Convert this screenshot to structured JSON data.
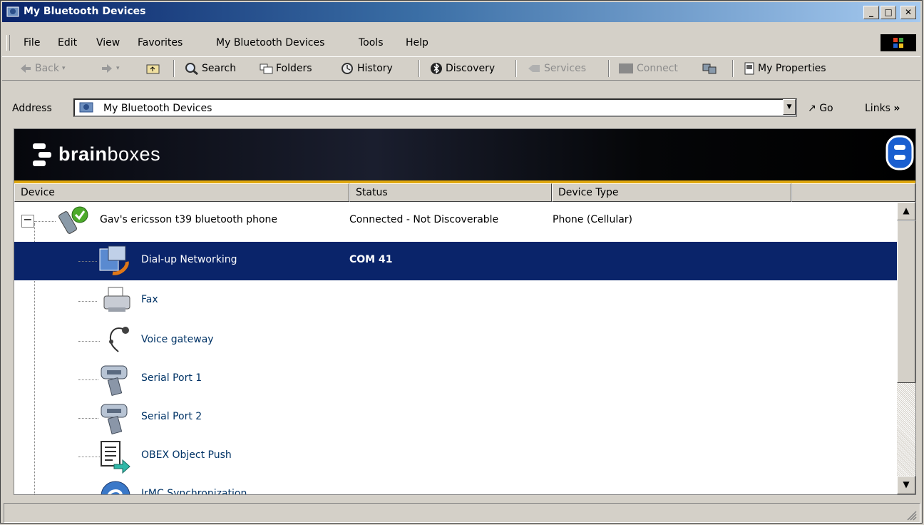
{
  "window": {
    "title": "My Bluetooth Devices",
    "controls": [
      "minimize",
      "maximize",
      "close"
    ]
  },
  "menu": {
    "items": [
      {
        "label": "File"
      },
      {
        "label": "Edit"
      },
      {
        "label": "View"
      },
      {
        "label": "Favorites"
      },
      {
        "label": "My Bluetooth Devices"
      },
      {
        "label": "Tools"
      },
      {
        "label": "Help"
      }
    ]
  },
  "toolbar": {
    "back": "Back",
    "search": "Search",
    "folders": "Folders",
    "history": "History",
    "discovery": "Discovery",
    "services": "Services",
    "connect": "Connect",
    "my_properties": "My Properties"
  },
  "address": {
    "label": "Address",
    "value": "My Bluetooth Devices",
    "go": "Go",
    "links": "Links"
  },
  "banner": {
    "brand_bold": "brain",
    "brand_light": "boxes"
  },
  "columns": [
    "Device",
    "Status",
    "Device Type"
  ],
  "devices": [
    {
      "label": "Gav's ericsson t39 bluetooth phone",
      "status": "Connected - Not Discoverable",
      "device_type": "Phone (Cellular)",
      "icon": "phone-connected-icon"
    },
    {
      "label": "Dial-up Networking",
      "status": "COM 41",
      "device_type": "",
      "icon": "dialup-networking-icon",
      "selected": true
    },
    {
      "label": "Fax",
      "status": "",
      "device_type": "",
      "icon": "fax-icon"
    },
    {
      "label": "Voice gateway",
      "status": "",
      "device_type": "",
      "icon": "headset-icon"
    },
    {
      "label": "Serial Port 1",
      "status": "",
      "device_type": "",
      "icon": "serial-port-icon"
    },
    {
      "label": "Serial Port 2",
      "status": "",
      "device_type": "",
      "icon": "serial-port-icon"
    },
    {
      "label": "OBEX Object Push",
      "status": "",
      "device_type": "",
      "icon": "obex-push-icon"
    },
    {
      "label": "IrMC Synchronization",
      "status": "",
      "device_type": "",
      "icon": "sync-icon"
    }
  ],
  "colors": {
    "title_start": "#0a246a",
    "title_end": "#a6caf0",
    "selection": "#0a246a",
    "banner_accent": "#e0a810",
    "link_text": "#003366"
  }
}
